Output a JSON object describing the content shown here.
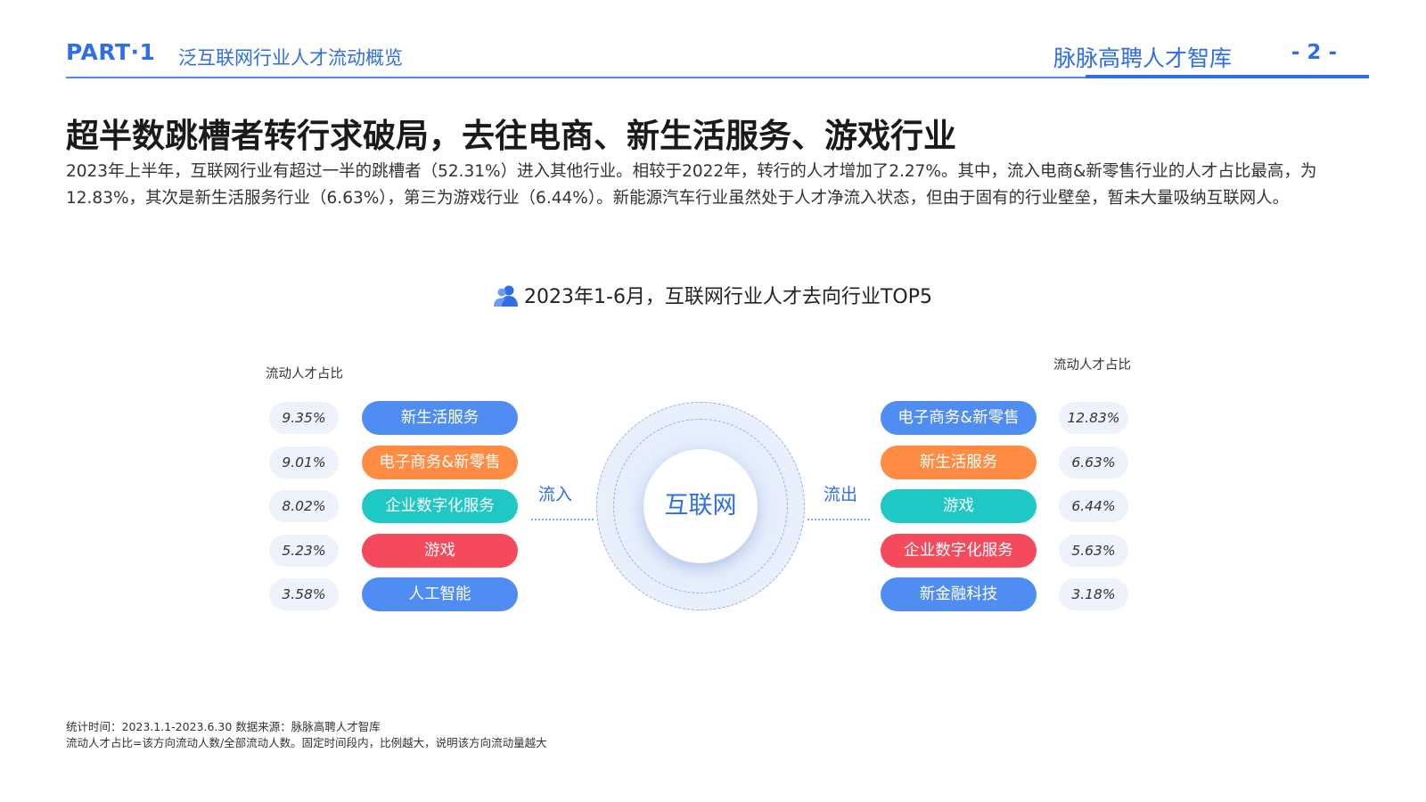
{
  "header": {
    "part": "PART·1",
    "section": "泛互联网行业人才流动概览",
    "brand": "脉脉高聘人才智库",
    "page_number": "- 2 -"
  },
  "title": "超半数跳槽者转行求破局，去往电商、新生活服务、游戏行业",
  "description": "2023年上半年，互联网行业有超过一半的跳槽者（52.31%）进入其他行业。相较于2022年，转行的人才增加了2.27%。其中，流入电商&新零售行业的人才占比最高，为12.83%，其次是新生活服务行业（6.63%），第三为游戏行业（6.44%）。新能源汽车行业虽然处于人才净流入状态，但由于固有的行业壁垒，暂未大量吸纳互联网人。",
  "chart_data": {
    "type": "table",
    "title": "2023年1-6月，互联网行业人才去向行业TOP5",
    "center": "互联网",
    "inflow": {
      "label": "流入",
      "column_label": "流动人才占比",
      "items": [
        {
          "name": "新生活服务",
          "value": "9.35%",
          "color": "#4f8df2"
        },
        {
          "name": "电子商务&新零售",
          "value": "9.01%",
          "color": "#ff8c42"
        },
        {
          "name": "企业数字化服务",
          "value": "8.02%",
          "color": "#1fc8c4"
        },
        {
          "name": "游戏",
          "value": "5.23%",
          "color": "#f5495c"
        },
        {
          "name": "人工智能",
          "value": "3.58%",
          "color": "#4f8df2"
        }
      ]
    },
    "outflow": {
      "label": "流出",
      "column_label": "流动人才占比",
      "items": [
        {
          "name": "电子商务&新零售",
          "value": "12.83%",
          "color": "#4f8df2"
        },
        {
          "name": "新生活服务",
          "value": "6.63%",
          "color": "#ff8c42"
        },
        {
          "name": "游戏",
          "value": "6.44%",
          "color": "#1fc8c4"
        },
        {
          "name": "企业数字化服务",
          "value": "5.63%",
          "color": "#f5495c"
        },
        {
          "name": "新金融科技",
          "value": "3.18%",
          "color": "#4f8df2"
        }
      ]
    }
  },
  "footer": {
    "line1": "统计时间：2023.1.1-2023.6.30    数据来源：脉脉高聘人才智库",
    "line2": "流动人才占比=该方向流动人数/全部流动人数。固定时间段内，比例越大，说明该方向流动量越大"
  },
  "icons": {
    "chart_title_icon": "people-icon"
  }
}
